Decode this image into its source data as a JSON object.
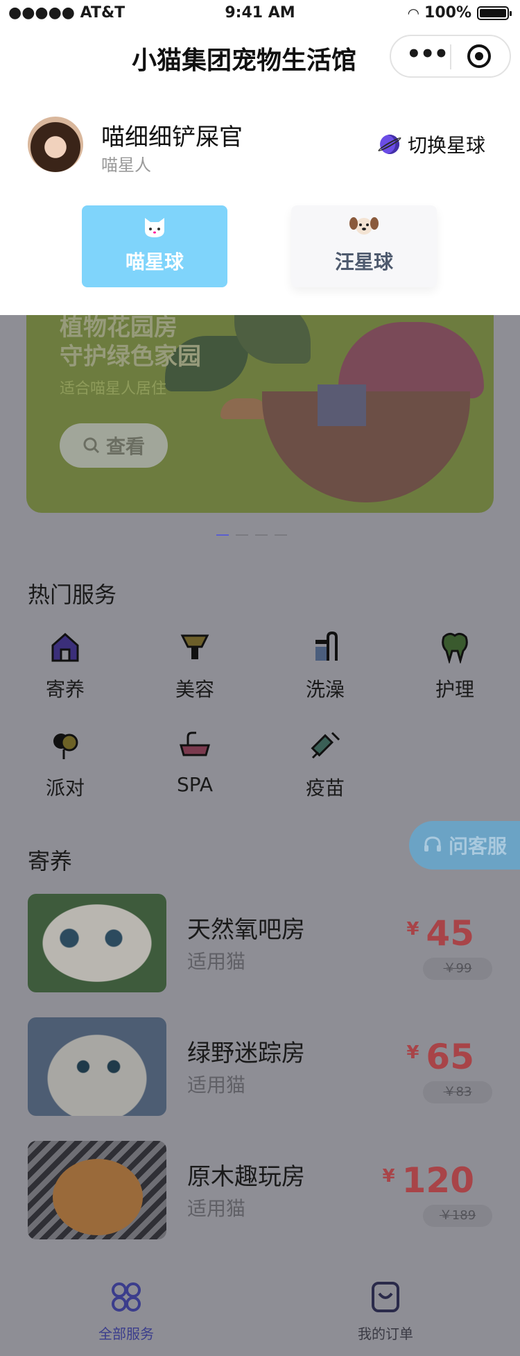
{
  "status_bar": {
    "carrier": "●●●●● AT&T",
    "time": "9:41 AM",
    "battery": "100%"
  },
  "nav": {
    "title": "小猫集团宠物生活馆",
    "more_icon": "more-dots-icon",
    "close_icon": "target-icon"
  },
  "user": {
    "name": "喵细细铲屎官",
    "role": "喵星人",
    "switch_label": "切换星球"
  },
  "planet_tabs": [
    {
      "label": "喵星球",
      "icon": "cat-face-icon",
      "active": true
    },
    {
      "label": "汪星球",
      "icon": "dog-face-icon",
      "active": false
    }
  ],
  "banner": {
    "line1": "植物花园房",
    "line2": "守护绿色家园",
    "subtitle": "适合喵星人居住",
    "button": "查看",
    "pages": 4,
    "active_page": 0
  },
  "services": {
    "title": "热门服务",
    "items": [
      {
        "label": "寄养",
        "icon": "house-icon"
      },
      {
        "label": "美容",
        "icon": "hair-dryer-icon"
      },
      {
        "label": "洗澡",
        "icon": "shower-icon"
      },
      {
        "label": "护理",
        "icon": "tooth-icon"
      },
      {
        "label": "派对",
        "icon": "balloon-icon"
      },
      {
        "label": "SPA",
        "icon": "bathtub-icon"
      },
      {
        "label": "疫苗",
        "icon": "syringe-icon"
      }
    ]
  },
  "customer_service": {
    "label": "问客服",
    "icon": "headset-icon"
  },
  "boarding": {
    "title": "寄养",
    "rooms": [
      {
        "name": "天然氧吧房",
        "sub": "适用猫",
        "currency": "¥",
        "price": "45",
        "old_price": "￥99"
      },
      {
        "name": "绿野迷踪房",
        "sub": "适用猫",
        "currency": "¥",
        "price": "65",
        "old_price": "￥83"
      },
      {
        "name": "原木趣玩房",
        "sub": "适用猫",
        "currency": "¥",
        "price": "120",
        "old_price": "￥189"
      }
    ]
  },
  "tabbar": {
    "items": [
      {
        "label": "全部服务",
        "icon": "all-services-icon",
        "active": true
      },
      {
        "label": "我的订单",
        "icon": "order-bag-icon",
        "active": false
      }
    ]
  },
  "colors": {
    "accent": "#5b5fcf",
    "cat_tab": "#7fd4fb",
    "price": "#a84448",
    "overlay": "#8e8e95"
  }
}
